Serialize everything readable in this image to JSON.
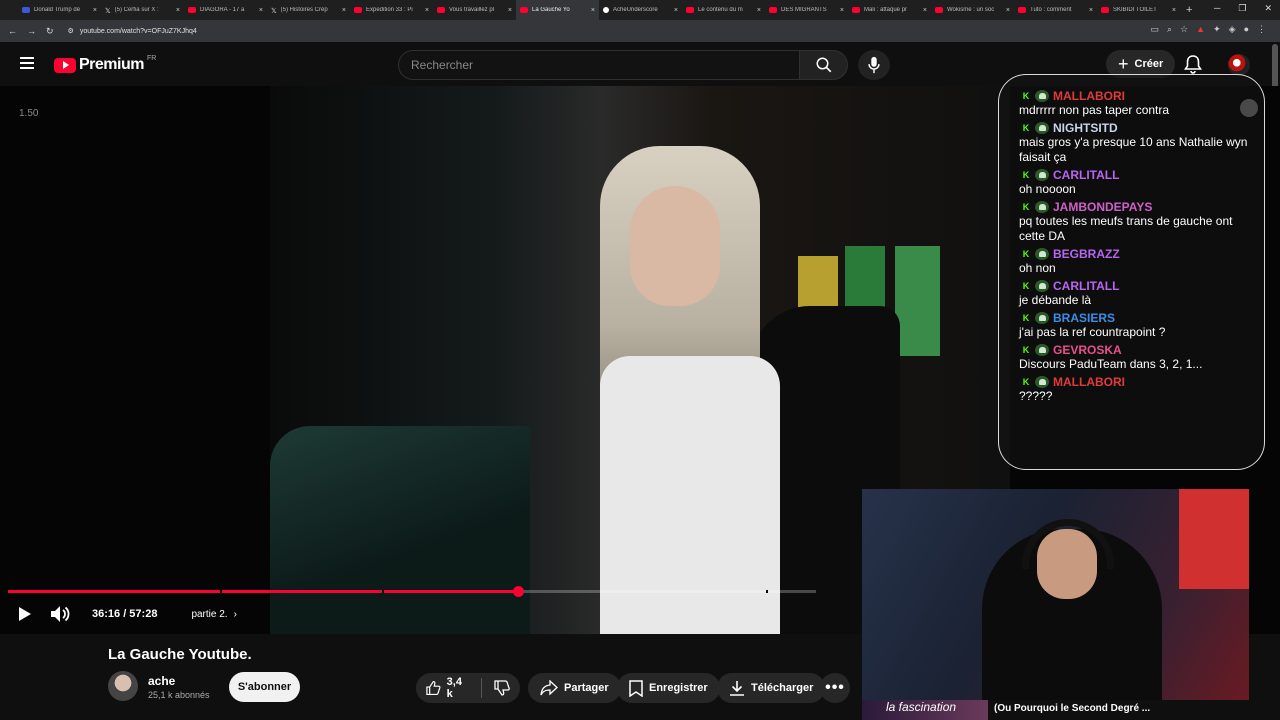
{
  "browser": {
    "tabs": [
      {
        "label": "Donald Trump dé",
        "icon": "news"
      },
      {
        "label": "(5) Cerfia sur X :",
        "icon": "x"
      },
      {
        "label": "DIAGORA - 17 a",
        "icon": "youtube"
      },
      {
        "label": "(5) Histoires Crép",
        "icon": "x"
      },
      {
        "label": "Expedition 33 : Pi",
        "icon": "youtube"
      },
      {
        "label": "Vous travaillez pl",
        "icon": "youtube"
      },
      {
        "label": "La Gauche Yo",
        "icon": "youtube",
        "active": true
      },
      {
        "label": "AcheUnderscore",
        "icon": "generic"
      },
      {
        "label": "Le contenu du m",
        "icon": "youtube"
      },
      {
        "label": "DES MIGRANTS",
        "icon": "youtube"
      },
      {
        "label": "Mali : attaque pr",
        "icon": "youtube"
      },
      {
        "label": "Wokisme : un soc",
        "icon": "youtube"
      },
      {
        "label": "Tuto : comment",
        "icon": "youtube"
      },
      {
        "label": "SKIBIDI TOILET",
        "icon": "youtube"
      }
    ],
    "url": "youtube.com/watch?v=OFJuZ7KJhq4"
  },
  "header": {
    "brand": "Premium",
    "country": "FR",
    "search_placeholder": "Rechercher",
    "create_label": "Créer"
  },
  "player": {
    "speed": "1.50",
    "time": "36:16 / 57:28",
    "chapter": "partie 2.",
    "progress_fraction": 0.631
  },
  "chat": {
    "messages": [
      {
        "user": "MALLABORI",
        "color": "#e23a3a",
        "text": "mdrrrrr non pas taper contra"
      },
      {
        "user": "NIGHTSITD",
        "color": "#c8d4e8",
        "text": "mais gros y'a presque 10 ans Nathalie wyn faisait ça"
      },
      {
        "user": "CARLITALL",
        "color": "#b865f0",
        "text": "oh noooon"
      },
      {
        "user": "JAMBONDEPAYS",
        "color": "#d060c8",
        "text": "pq toutes les meufs trans de gauche ont cette DA"
      },
      {
        "user": "BEGBRAZZ",
        "color": "#b865f0",
        "text": "oh non"
      },
      {
        "user": "CARLITALL",
        "color": "#b865f0",
        "text": "je débande là"
      },
      {
        "user": "BRASIERS",
        "color": "#3a8ee8",
        "text": "j'ai pas la ref countrapoint ?"
      },
      {
        "user": "GEVROSKA",
        "color": "#e8508a",
        "text": "Discours PaduTeam dans 3, 2, 1..."
      },
      {
        "user": "MALLABORI",
        "color": "#e23a3a",
        "text": "?????"
      }
    ]
  },
  "video": {
    "title": "La Gauche Youtube.",
    "channel": "ache",
    "subscribers": "25,1 k abonnés",
    "subscribe_label": "S'abonner",
    "likes": "3,4 k",
    "share_label": "Partager",
    "save_label": "Enregistrer",
    "download_label": "Télécharger"
  },
  "overlay": {
    "caption_thumb": "la fascination",
    "caption_title": "(Ou Pourquoi le Second Degré ..."
  },
  "colors": {
    "accent": "#ff0033",
    "background": "#0f0f0f",
    "chip": "#272727"
  }
}
